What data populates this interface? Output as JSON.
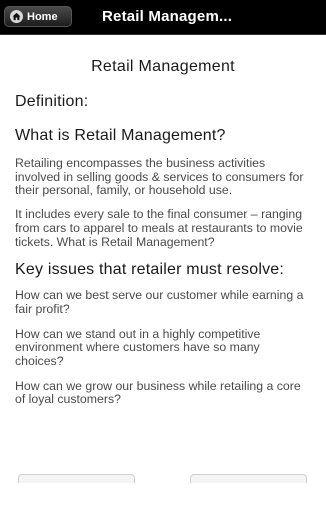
{
  "header": {
    "home_label": "Home",
    "title": "Retail Managem..."
  },
  "main": {
    "page_title": "Retail Management",
    "definition_heading": "Definition:",
    "what_heading": "What is Retail Management?",
    "paragraphs": [
      "Retailing encompasses the business activities involved in selling goods & services to consumers for their personal, family, or household use.",
      "It includes every sale to the final consumer – ranging from cars to apparel to meals at restaurants to movie tickets. What is Retail Management?"
    ],
    "key_heading": "Key issues that retailer must resolve:",
    "questions": [
      "How can we best serve our customer while earning a fair profit?",
      "How can we stand out in a highly competitive environment where customers have so many choices?",
      "How can we grow our business while retailing a core of loyal customers?"
    ]
  },
  "icons": {
    "home": "home-icon"
  },
  "colors": {
    "topbar": "#000000",
    "heading_text": "#1a1a1a",
    "body_text": "#4a4a4a"
  }
}
